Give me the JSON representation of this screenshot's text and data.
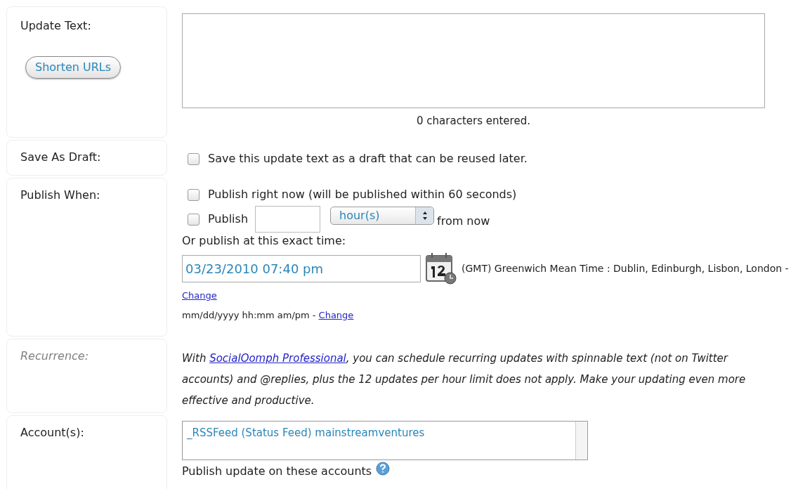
{
  "update_text": {
    "label": "Update Text:",
    "shorten_button": "Shorten URLs",
    "counter": "0 characters entered."
  },
  "save_as_draft": {
    "label": "Save As Draft:",
    "checked": false,
    "text": "Save this update text as a draft that can be reused later."
  },
  "publish_when": {
    "label": "Publish When:",
    "now": {
      "checked": false,
      "text": "Publish right now (will be published within 60 seconds)"
    },
    "relative": {
      "checked": false,
      "text": "Publish",
      "unit": "hour(s)",
      "suffix": "from now"
    },
    "exact_label": "Or publish at this exact time:",
    "datetime": "03/23/2010 07:40 pm",
    "timezone": "(GMT) Greenwich Mean Time : Dublin, Edinburgh, Lisbon, London -",
    "timezone_change": "Change",
    "format": "mm/dd/yyyy hh:mm am/pm -",
    "format_change": "Change"
  },
  "recurrence": {
    "label": "Recurrence:",
    "before": "With ",
    "link": "SocialOomph Professional",
    "after": ", you can schedule recurring updates with spinnable text (not on Twitter accounts) and @replies, plus the 12 updates per hour limit does not apply. Make your updating even more effective and productive."
  },
  "accounts": {
    "label": "Account(s):",
    "items": [
      {
        "name": "_RSSFeed (Status Feed) mainstreamventures",
        "selected": false
      }
    ],
    "hint": "Publish update on these accounts"
  }
}
